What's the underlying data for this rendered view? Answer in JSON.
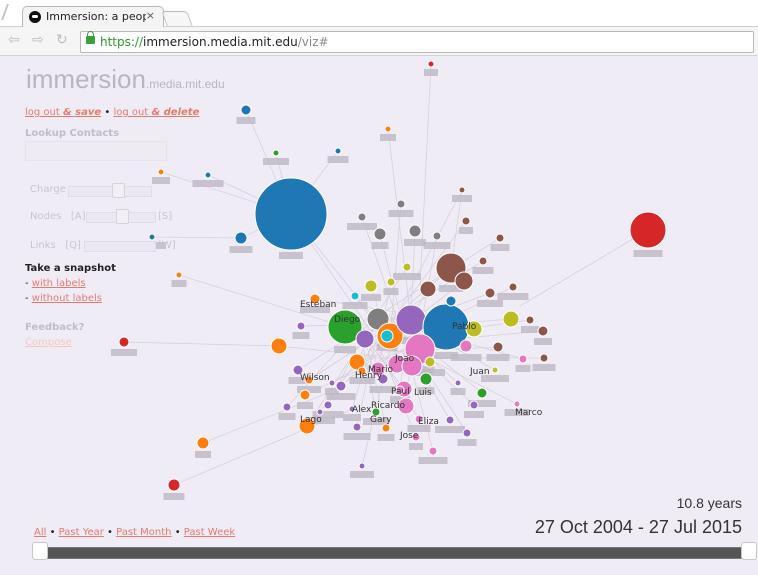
{
  "browser": {
    "tab_title": "Immersion: a people-",
    "tab_close": "×",
    "back_icon": "back-arrow-icon",
    "forward_icon": "forward-arrow-icon",
    "reload_icon": "reload-icon",
    "url_scheme": "https://",
    "url_host": "immersion.media.mit.edu",
    "url_path": "/viz#"
  },
  "logo": {
    "main": "immersion",
    "sub": ".media.mit.edu"
  },
  "account": {
    "logout_save_prefix": "log out ",
    "logout_save_suffix": "& save",
    "separator": " • ",
    "logout_delete_prefix": "log out ",
    "logout_delete_suffix": "& delete"
  },
  "lookup": {
    "label": "Lookup Contacts",
    "value": ""
  },
  "controls": {
    "charge_label": "Charge",
    "nodes_label": "Nodes",
    "nodes_min": "[A]",
    "nodes_max": "[S]",
    "links_label": "Links",
    "links_min": "[Q]",
    "links_max": "[W]"
  },
  "snapshot": {
    "heading": "Take a snapshot",
    "with_labels": "with labels",
    "without_labels": "without labels",
    "bullet": "- "
  },
  "feedback": {
    "label": "Feedback?",
    "compose": "Compose"
  },
  "stats": {
    "duration": "10.8 years",
    "range": "27 Oct 2004 - 27 Jul 2015"
  },
  "periods": {
    "all": "All",
    "past_year": "Past Year",
    "past_month": "Past Month",
    "past_week": "Past Week",
    "separator": " • "
  },
  "colors": {
    "background": "#f0ecf5",
    "link": "#e57b6d",
    "blue": "#1f77b4",
    "orange": "#ff7f0e",
    "green": "#2ca02c",
    "red": "#d62728",
    "purple": "#9467bd",
    "brown": "#8c564b",
    "pink": "#e377c2",
    "gray": "#7f7f7f",
    "olive": "#bcbd22",
    "cyan": "#17becf"
  },
  "graph": {
    "visible_labels": [
      "Esteban",
      "Diego",
      "Alex",
      "Henry",
      "Paul",
      "Luis",
      "Juan",
      "Mario",
      "Ricardo",
      "Gary",
      "Wilson",
      "Pablo",
      "Jose",
      "Eliza",
      "Marco",
      "Lago",
      "Joao"
    ]
  }
}
